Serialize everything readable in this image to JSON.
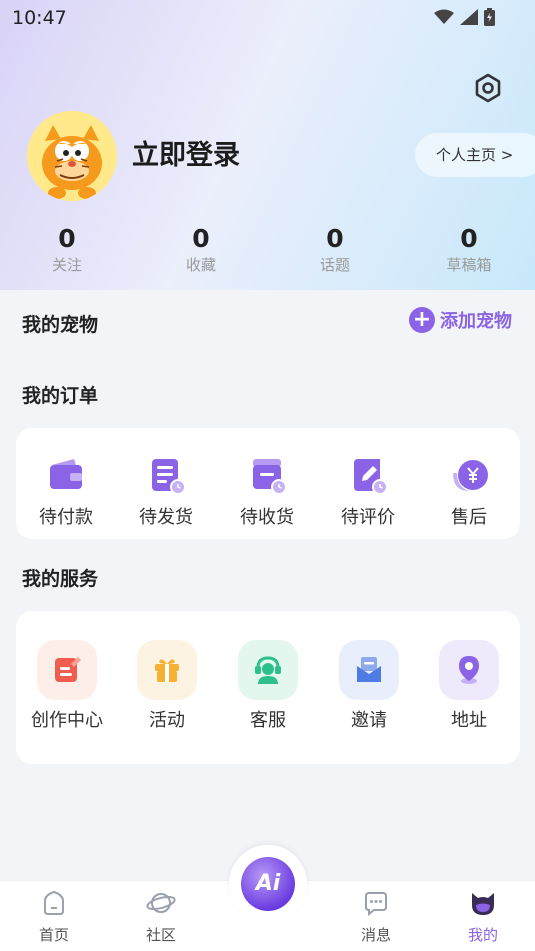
{
  "status_bar": {
    "time": "10:47"
  },
  "profile": {
    "login_label": "立即登录",
    "homepage_label": "个人主页 >"
  },
  "stats": [
    {
      "value": "0",
      "label": "关注"
    },
    {
      "value": "0",
      "label": "收藏"
    },
    {
      "value": "0",
      "label": "话题"
    },
    {
      "value": "0",
      "label": "草稿箱"
    }
  ],
  "pets": {
    "title": "我的宠物",
    "add_label": "添加宠物"
  },
  "orders": {
    "title": "我的订单",
    "items": [
      {
        "label": "待付款",
        "icon": "wallet-icon"
      },
      {
        "label": "待发货",
        "icon": "list-clock-icon"
      },
      {
        "label": "待收货",
        "icon": "box-clock-icon"
      },
      {
        "label": "待评价",
        "icon": "edit-clock-icon"
      },
      {
        "label": "售后",
        "icon": "yen-coin-icon"
      }
    ]
  },
  "services": {
    "title": "我的服务",
    "items": [
      {
        "label": "创作中心",
        "icon": "create-icon",
        "bg": "#fdeeea",
        "color": "#ef5d4e"
      },
      {
        "label": "活动",
        "icon": "gift-icon",
        "bg": "#fdf3e3",
        "color": "#f6b133"
      },
      {
        "label": "客服",
        "icon": "support-icon",
        "bg": "#e3f7ef",
        "color": "#2dc08c"
      },
      {
        "label": "邀请",
        "icon": "invite-mail-icon",
        "bg": "#e9eefc",
        "color": "#4f7be4"
      },
      {
        "label": "地址",
        "icon": "location-icon",
        "bg": "#efe9fc",
        "color": "#8a63e6"
      }
    ]
  },
  "tabbar": {
    "items": [
      {
        "label": "首页",
        "icon": "home-icon"
      },
      {
        "label": "社区",
        "icon": "planet-icon"
      },
      {
        "label": "消息",
        "icon": "message-icon"
      },
      {
        "label": "我的",
        "icon": "cat-face-icon",
        "active": true
      }
    ],
    "center_label": "Ai"
  },
  "colors": {
    "accent": "#8a63e6"
  }
}
